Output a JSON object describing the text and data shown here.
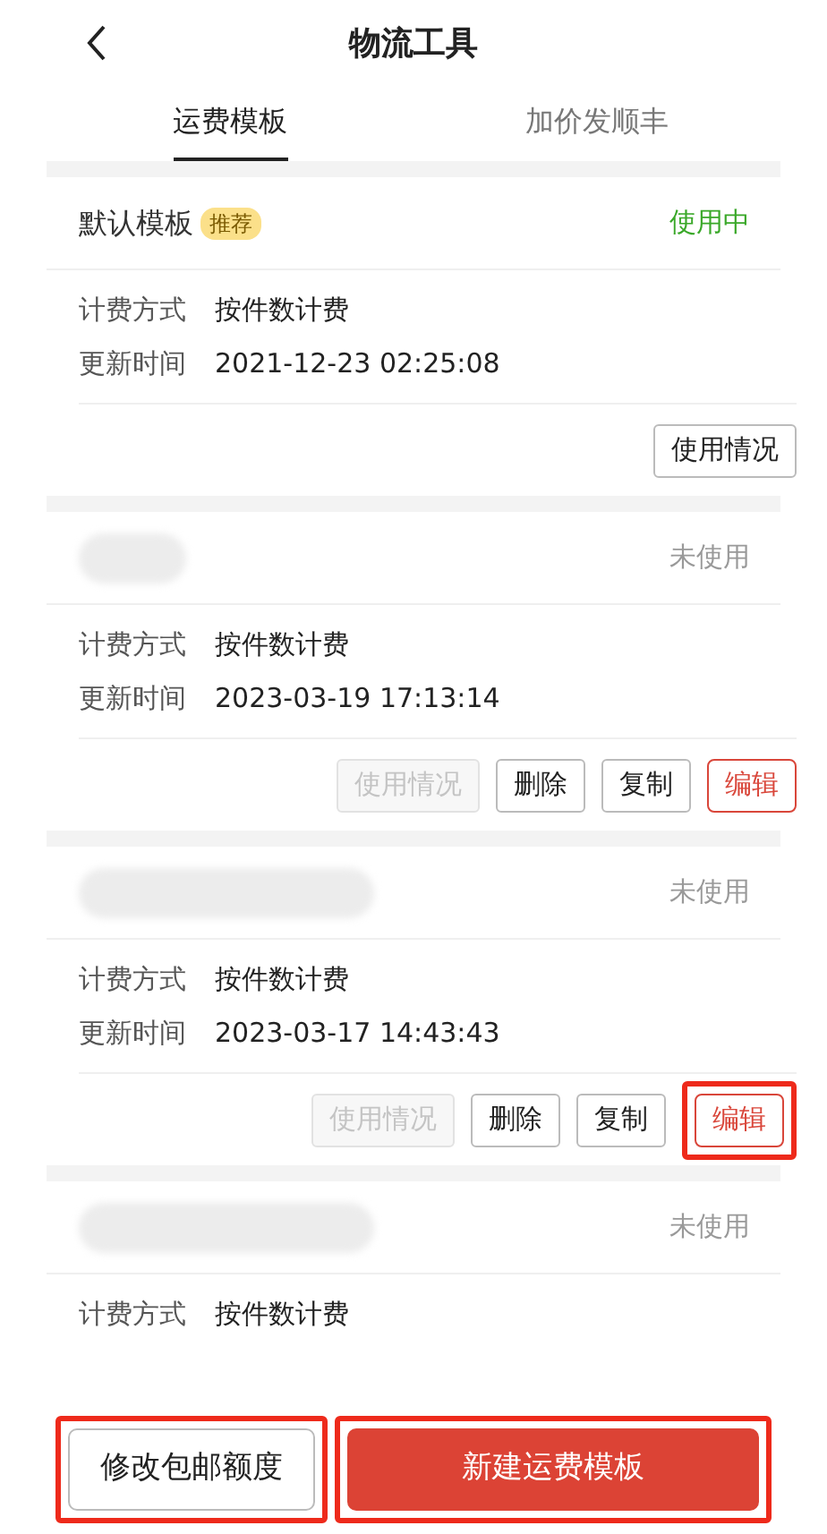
{
  "header": {
    "back_icon": true,
    "title": "物流工具"
  },
  "tabs": [
    {
      "label": "运费模板",
      "selected": true
    },
    {
      "label": "加价发顺丰",
      "selected": false
    }
  ],
  "templates": [
    {
      "redacted": false,
      "name": "默认模板",
      "badge": "推荐",
      "status": "使用中",
      "in_use": true,
      "fields": [
        {
          "label": "计费方式",
          "value": "按件数计费"
        },
        {
          "label": "更新时间",
          "value": "2021-12-23 02:25:08"
        }
      ],
      "actions": [
        {
          "label": "使用情况",
          "kind": "outline",
          "disabled": false,
          "highlighted": false
        }
      ]
    },
    {
      "redacted": true,
      "status": "未使用",
      "in_use": false,
      "fields": [
        {
          "label": "计费方式",
          "value": "按件数计费"
        },
        {
          "label": "更新时间",
          "value": "2023-03-19 17:13:14"
        }
      ],
      "actions": [
        {
          "label": "使用情况",
          "kind": "outline",
          "disabled": true,
          "highlighted": false
        },
        {
          "label": "删除",
          "kind": "outline",
          "disabled": false,
          "highlighted": false
        },
        {
          "label": "复制",
          "kind": "outline",
          "disabled": false,
          "highlighted": false
        },
        {
          "label": "编辑",
          "kind": "accent",
          "disabled": false,
          "highlighted": false
        }
      ]
    },
    {
      "redacted": true,
      "status": "未使用",
      "in_use": false,
      "fields": [
        {
          "label": "计费方式",
          "value": "按件数计费"
        },
        {
          "label": "更新时间",
          "value": "2023-03-17 14:43:43"
        }
      ],
      "actions": [
        {
          "label": "使用情况",
          "kind": "outline",
          "disabled": true,
          "highlighted": false
        },
        {
          "label": "删除",
          "kind": "outline",
          "disabled": false,
          "highlighted": false
        },
        {
          "label": "复制",
          "kind": "outline",
          "disabled": false,
          "highlighted": false
        },
        {
          "label": "编辑",
          "kind": "accent",
          "disabled": false,
          "highlighted": true
        }
      ]
    },
    {
      "redacted": true,
      "status": "未使用",
      "in_use": false,
      "fields": [
        {
          "label": "计费方式",
          "value": "按件数计费"
        }
      ]
    }
  ],
  "bottom_buttons": [
    {
      "label": "修改包邮额度",
      "kind": "outline",
      "highlighted": true
    },
    {
      "label": "新建运费模板",
      "kind": "primary",
      "highlighted": true
    }
  ]
}
